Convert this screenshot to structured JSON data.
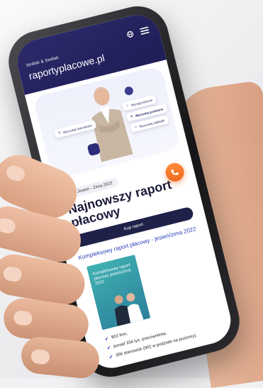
{
  "header": {
    "brand_small": "Sedlak & Sedlak",
    "brand": "raportyplacowe.pl"
  },
  "hero": {
    "chips": [
      {
        "label": "Wyszukaj stanowisko",
        "icon": "search-icon"
      },
      {
        "label": "Wynagrodzenie"
      },
      {
        "label": "Wyszukaj podobne"
      },
      {
        "label": "Wyszukaj zakładki"
      }
    ]
  },
  "content": {
    "badge": "Jesień - Zima 2022",
    "title": "Najnowszy raport płacowy",
    "cta": "Kup raport",
    "link": "Kompleksowy raport płacowy - jesień/zima 2022",
    "cover_title": "Kompleksowy raport płacowy jesień/zima 2022",
    "bullets": [
      "903 firm,",
      "ponad 334 tys. pracowników,",
      "366 stanowisk (902 w podziale na poziomy),"
    ]
  },
  "colors": {
    "header_bg": "#232260",
    "cta_bg": "#1f2148",
    "link": "#2a3fb8",
    "call_button": "#f26e22"
  },
  "icons": {
    "globe": "globe-icon",
    "menu": "hamburger-menu-icon",
    "call": "phone-icon"
  }
}
